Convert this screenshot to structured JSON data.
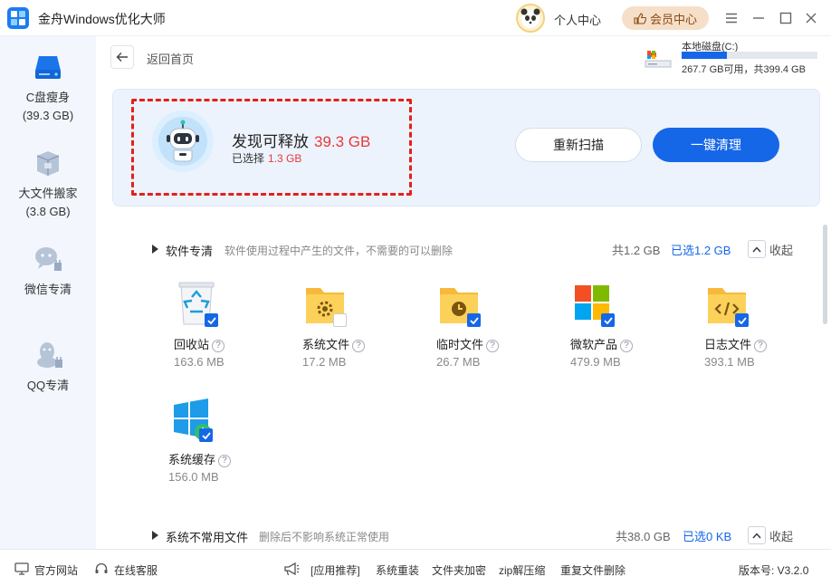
{
  "app": {
    "title": "金舟Windows优化大师"
  },
  "header": {
    "personal_center": "个人中心",
    "member_center": "会员中心"
  },
  "sidebar": {
    "items": [
      {
        "label": "C盘瘦身",
        "sub": "(39.3 GB)"
      },
      {
        "label": "大文件搬家",
        "sub": "(3.8 GB)"
      },
      {
        "label": "微信专清",
        "sub": ""
      },
      {
        "label": "QQ专清",
        "sub": ""
      }
    ]
  },
  "nav": {
    "back_label": "返回首页"
  },
  "disk": {
    "name": "本地磁盘(C:)",
    "info": "267.7 GB可用，共399.4 GB",
    "used_fraction": 0.33
  },
  "scan": {
    "found_label": "发现可释放",
    "found_value": "39.3 GB",
    "selected_label": "已选择",
    "selected_value": "1.3 GB",
    "rescan_label": "重新扫描",
    "clean_label": "一键清理"
  },
  "sections": [
    {
      "title": "软件专清",
      "desc": "软件使用过程中产生的文件，不需要的可以删除",
      "total": "共1.2 GB",
      "selected": "已选1.2 GB",
      "collapse": "收起",
      "items": [
        {
          "name": "回收站",
          "size": "163.6 MB",
          "checked": true
        },
        {
          "name": "系统文件",
          "size": "17.2 MB",
          "checked": false
        },
        {
          "name": "临时文件",
          "size": "26.7 MB",
          "checked": true
        },
        {
          "name": "微软产品",
          "size": "479.9 MB",
          "checked": true
        },
        {
          "name": "日志文件",
          "size": "393.1 MB",
          "checked": true
        },
        {
          "name": "系统缓存",
          "size": "156.0 MB",
          "checked": true
        }
      ]
    },
    {
      "title": "系统不常用文件",
      "desc": "删除后不影响系统正常使用",
      "total": "共38.0 GB",
      "selected": "已选0 KB",
      "collapse": "收起"
    }
  ],
  "footer": {
    "website": "官方网站",
    "support": "在线客服",
    "recommend": "[应用推荐]",
    "links": [
      "系统重装",
      "文件夹加密",
      "zip解压缩",
      "重复文件删除"
    ],
    "version": "版本号: V3.2.0"
  },
  "colors": {
    "accent": "#1667e8",
    "highlight": "#e8383d",
    "sidebar_bg": "#f3f7fd"
  }
}
